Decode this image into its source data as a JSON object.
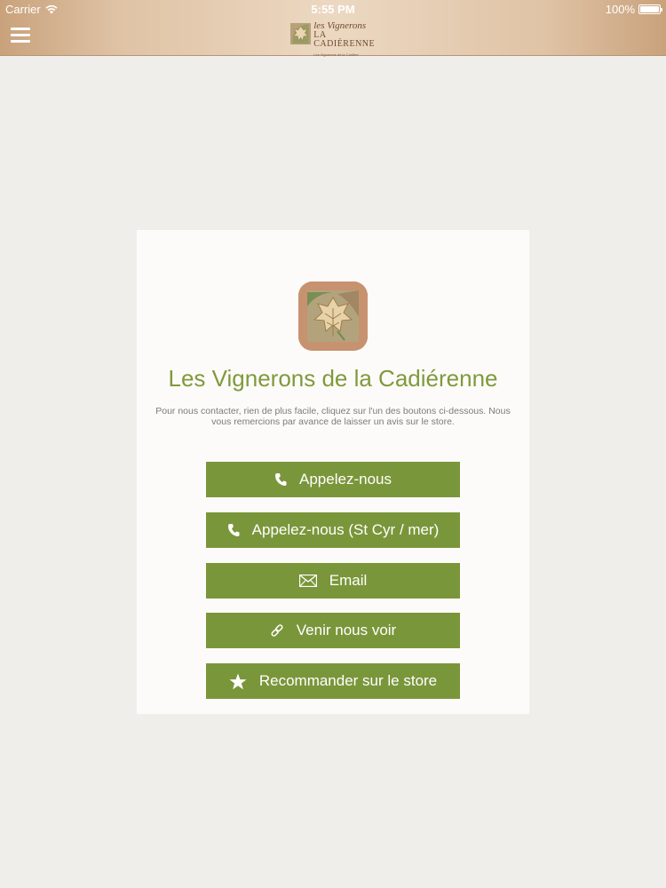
{
  "status_bar": {
    "carrier": "Carrier",
    "time": "5:55 PM",
    "battery": "100%"
  },
  "header": {
    "menu_icon": "hamburger-icon",
    "brand": {
      "line1": "les Vignerons",
      "line2": "LA CADIÉRENNE",
      "tagline": "Les Vignerons de la Cadière"
    }
  },
  "card": {
    "app_icon": "grape-leaf-icon",
    "title": "Les Vignerons de la Cadiérenne",
    "description": "Pour nous contacter, rien de plus facile, cliquez sur l'un des boutons ci-dessous. Nous vous remercions par avance de laisser un avis sur le store.",
    "buttons": [
      {
        "label": "Appelez-nous",
        "icon": "phone-icon"
      },
      {
        "label": "Appelez-nous (St Cyr / mer)",
        "icon": "phone-icon"
      },
      {
        "label": "Email",
        "icon": "envelope-icon"
      },
      {
        "label": "Venir nous voir",
        "icon": "link-icon"
      },
      {
        "label": "Recommander sur le store",
        "icon": "star-icon"
      }
    ]
  },
  "colors": {
    "header": "#dfc3a5",
    "background": "#f0eeeb",
    "card": "#fdfbf9",
    "accent": "#7a963a",
    "title": "#7f9a3c"
  }
}
